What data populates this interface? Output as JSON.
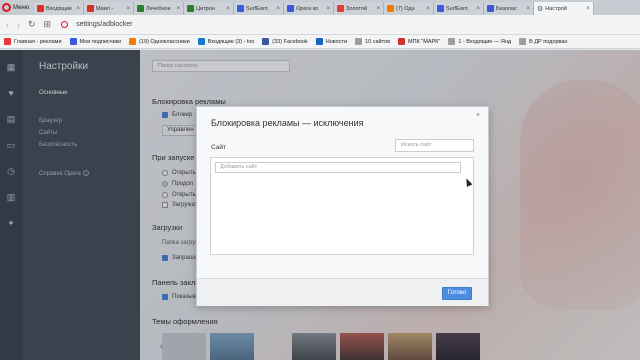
{
  "browser": {
    "menu_label": "Меню",
    "tabs": [
      {
        "title": "Входящие",
        "color": "#d93025"
      },
      {
        "title": "Маил -",
        "color": "#d93025"
      },
      {
        "title": "Лечебное",
        "color": "#2e7d32"
      },
      {
        "title": "Цитрон",
        "color": "#2e7d32"
      },
      {
        "title": "SurfEarn",
        "color": "#3b5bdb"
      },
      {
        "title": "Opera ко",
        "color": "#3b5bdb"
      },
      {
        "title": "Золотой",
        "color": "#e53935"
      },
      {
        "title": "(7) Одн",
        "color": "#f57c00"
      },
      {
        "title": "SurfEarn",
        "color": "#3b5bdb"
      },
      {
        "title": "Безопас",
        "color": "#3b5bdb"
      },
      {
        "title": "Настрой",
        "color": "#666666",
        "active": true
      }
    ],
    "url": "settings/adblocker",
    "bookmarks": [
      {
        "label": "Главная - реклами",
        "color": "#e53935"
      },
      {
        "label": "Мои подписчики",
        "color": "#3b5bdb"
      },
      {
        "label": "(19) Одноклассники",
        "color": "#f57c00"
      },
      {
        "label": "Входящие (3) - tvo",
        "color": "#1976d2"
      },
      {
        "label": "(33) Facebook",
        "color": "#3b5998"
      },
      {
        "label": "Новости",
        "color": "#1565c0"
      },
      {
        "label": "10 сайтов",
        "color": "#9e9e9e"
      },
      {
        "label": "МПК \"МАРК\"",
        "color": "#d32f2f"
      },
      {
        "label": "1 - Входящие — Янд",
        "color": "#9e9e9e"
      },
      {
        "label": "В ДР подорван",
        "color": "#9e9e9e"
      }
    ]
  },
  "settings_nav": {
    "title": "Настройки",
    "items": {
      "basic": "Основные",
      "browser": "Браузер",
      "sites": "Сайты",
      "security": "Безопасность",
      "help": "Справка Opera"
    }
  },
  "settings_page": {
    "search_placeholder": "Поиск настроек",
    "adblock_heading": "Блокировка рекламы",
    "adblock_checkbox": "Блокир",
    "adblock_manage_button": "Управлен",
    "startup_heading": "При запуске",
    "startup_options": [
      "Открыть",
      "Продол",
      "Открыть"
    ],
    "startup_checkbox": "Загружат",
    "downloads_heading": "Загрузки",
    "downloads_folder": "Папка загруз",
    "downloads_ask": "Запраши",
    "bookmarks_heading": "Панель закла",
    "bookmarks_show": "Показыв",
    "themes_heading": "Темы оформления"
  },
  "modal": {
    "title": "Блокировка рекламы — исключения",
    "site_label": "Сайт",
    "find_placeholder": "Искать сайт",
    "add_placeholder": "Добавить сайт",
    "done_label": "Готово",
    "close_glyph": "×"
  },
  "colors": {
    "accent": "#4c8de0",
    "sidebar": "#39434e",
    "rail": "#2f3943",
    "opera_red": "#e0141e"
  }
}
